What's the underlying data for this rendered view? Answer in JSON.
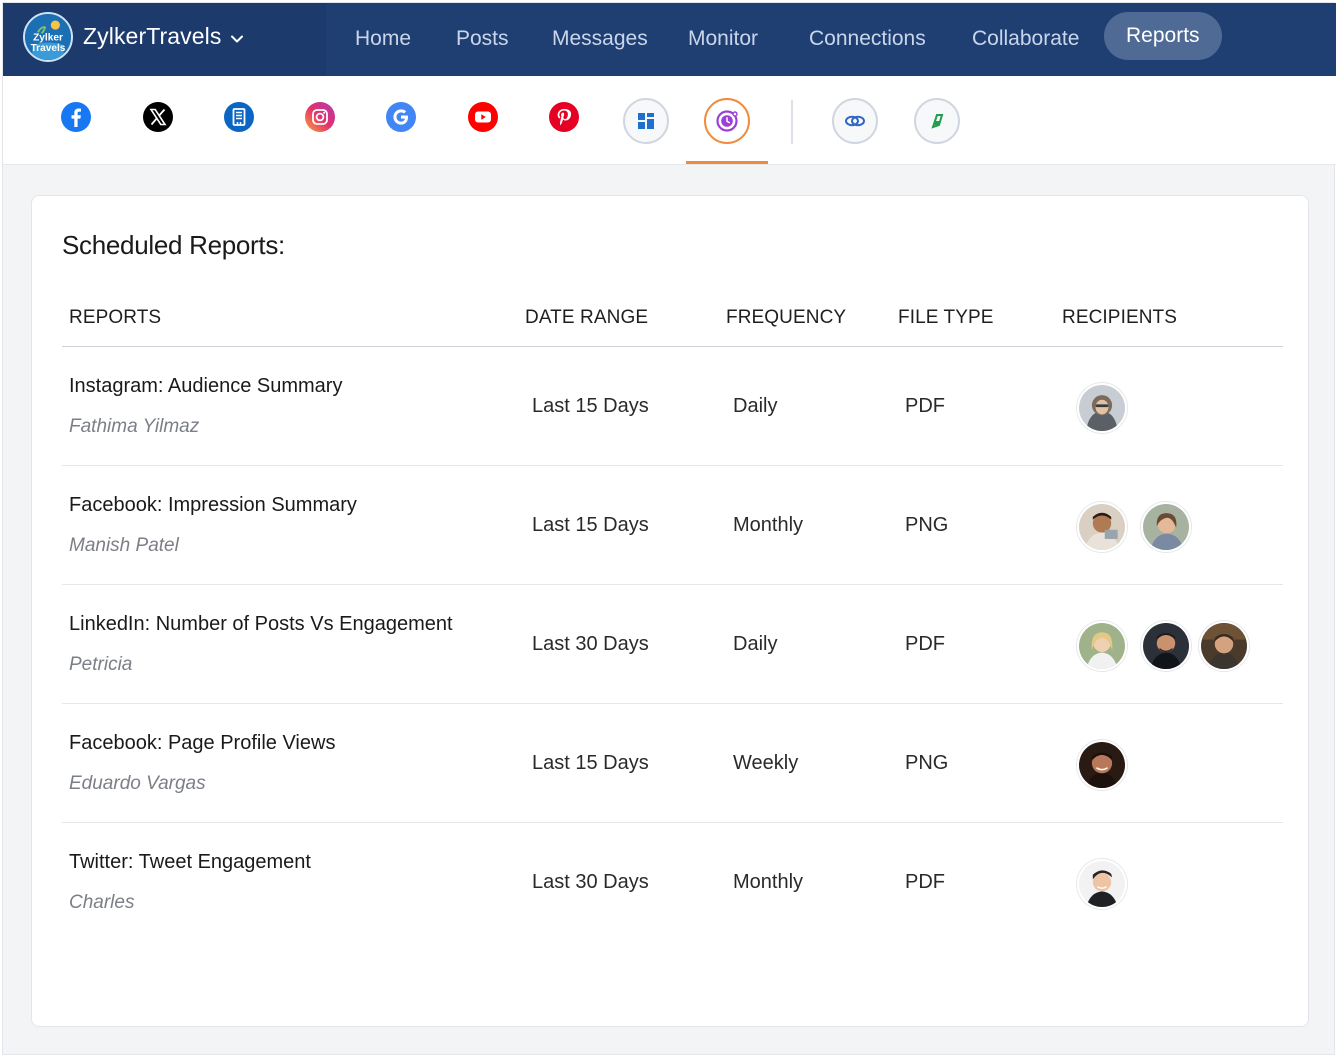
{
  "brand": {
    "name": "ZylkerTravels",
    "logo_text_1": "Zylker",
    "logo_text_2": "Travels"
  },
  "nav": {
    "items": [
      "Home",
      "Posts",
      "Messages",
      "Monitor",
      "Connections",
      "Collaborate"
    ],
    "active": "Reports"
  },
  "networks": [
    "facebook-icon",
    "x-icon",
    "linkedin-pages-icon",
    "instagram-icon",
    "google-icon",
    "youtube-icon",
    "pinterest-icon",
    "dashboard-icon",
    "scheduled-reports-icon",
    "integrations-icon",
    "zoho-icon"
  ],
  "card": {
    "title": "Scheduled Reports:",
    "headers": {
      "reports": "REPORTS",
      "date_range": "DATE RANGE",
      "frequency": "FREQUENCY",
      "file_type": "FILE TYPE",
      "recipients": "RECIPIENTS"
    }
  },
  "rows": [
    {
      "title": "Instagram: Audience Summary",
      "owner": "Fathima Yilmaz",
      "date_range": "Last 15 Days",
      "frequency": "Daily",
      "file_type": "PDF"
    },
    {
      "title": "Facebook: Impression Summary",
      "owner": "Manish Patel",
      "date_range": "Last 15 Days",
      "frequency": "Monthly",
      "file_type": "PNG"
    },
    {
      "title": "LinkedIn: Number of Posts Vs Engagement",
      "owner": "Petricia",
      "date_range": "Last 30 Days",
      "frequency": "Daily",
      "file_type": "PDF"
    },
    {
      "title": "Facebook: Page Profile Views",
      "owner": "Eduardo Vargas",
      "date_range": "Last 15 Days",
      "frequency": "Weekly",
      "file_type": "PNG"
    },
    {
      "title": "Twitter: Tweet Engagement",
      "owner": "Charles",
      "date_range": "Last 30 Days",
      "frequency": "Monthly",
      "file_type": "PDF"
    }
  ],
  "colors": {
    "nav_bg": "#1f3f73",
    "active_pill": "#4f6b95",
    "accent_underline": "#f08a3c"
  }
}
